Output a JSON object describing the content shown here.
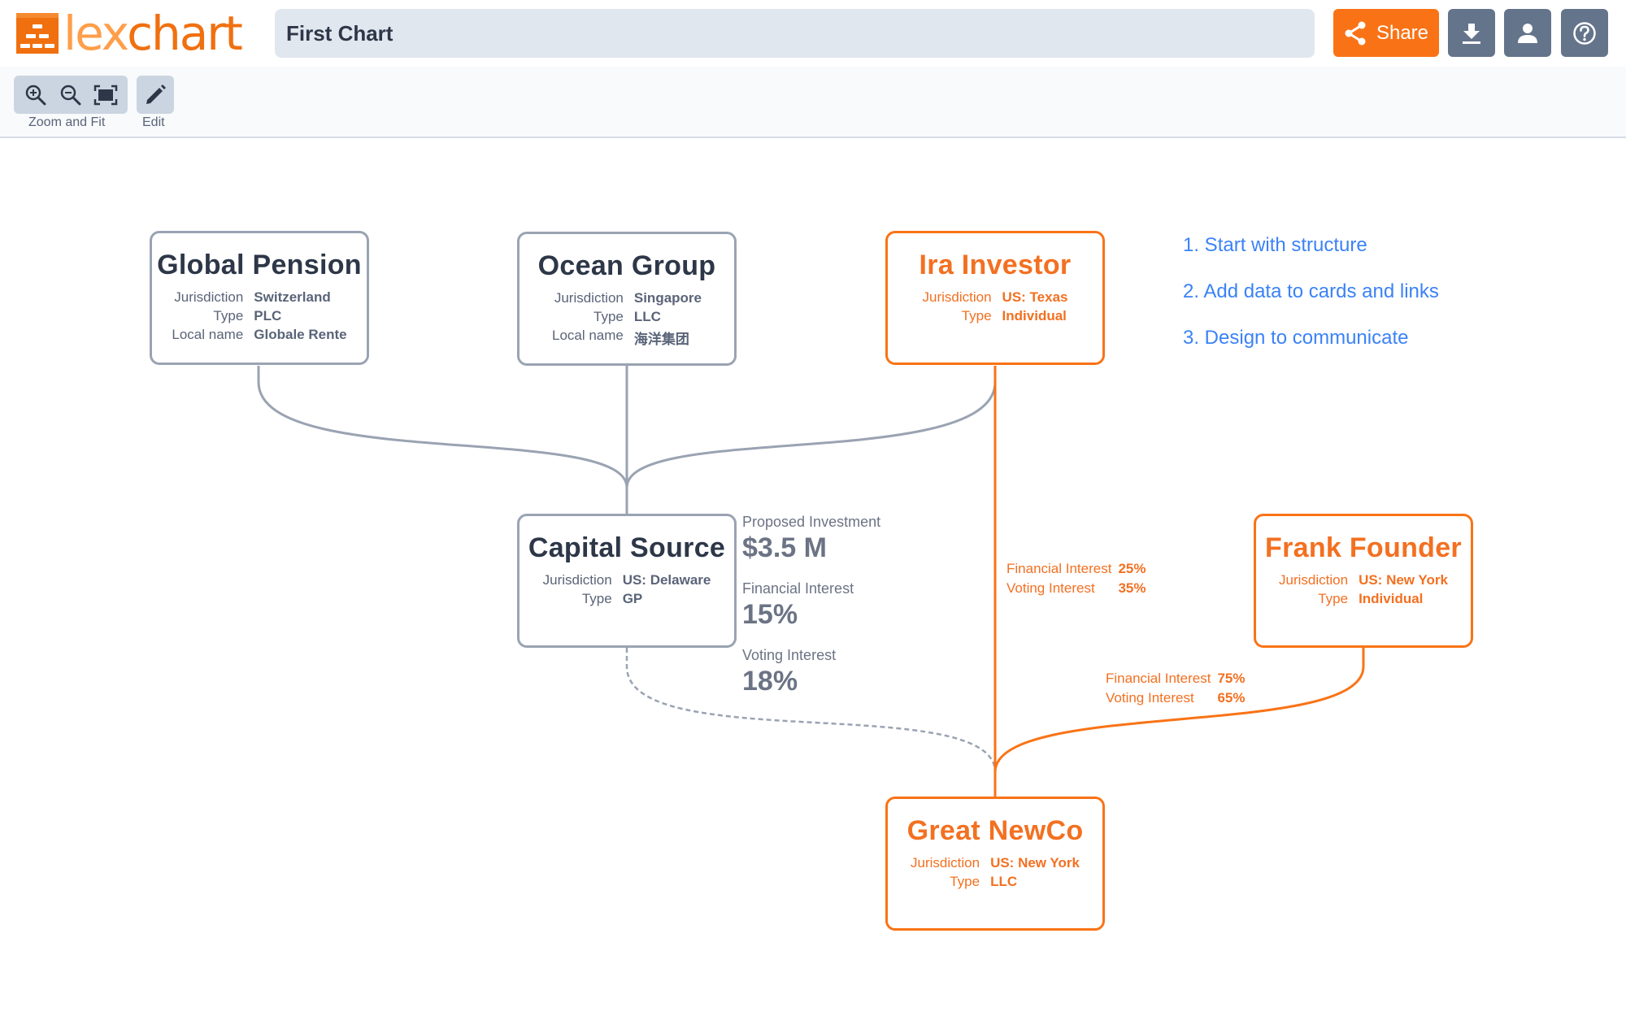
{
  "app": {
    "logo": {
      "part1": "lex",
      "part2": "chart"
    },
    "chart_title": "First Chart",
    "buttons": {
      "share": "Share",
      "download_icon": "download-icon",
      "user_icon": "user-icon",
      "help_icon": "help-icon"
    },
    "toolbar": {
      "zoom_group_label": "Zoom and Fit",
      "edit_label": "Edit",
      "icons": [
        "zoom-in-icon",
        "zoom-out-icon",
        "fit-screen-icon",
        "pencil-icon"
      ]
    }
  },
  "colors": {
    "brand_orange": "#F97316",
    "card_gray_border": "#9AA3B2",
    "link_gray": "#9AA3B2",
    "note_blue": "#3B82F6",
    "button_gray": "#64748B"
  },
  "entities": [
    {
      "id": "global-pension",
      "title": "Global Pension",
      "style": "gray",
      "rows": [
        {
          "label": "Jurisdiction",
          "value": "Switzerland"
        },
        {
          "label": "Type",
          "value": "PLC"
        },
        {
          "label": "Local name",
          "value": "Globale Rente"
        }
      ]
    },
    {
      "id": "ocean-group",
      "title": "Ocean Group",
      "style": "gray",
      "rows": [
        {
          "label": "Jurisdiction",
          "value": "Singapore"
        },
        {
          "label": "Type",
          "value": "LLC"
        },
        {
          "label": "Local name",
          "value": "海洋集团"
        }
      ]
    },
    {
      "id": "ira-investor",
      "title": "Ira Investor",
      "style": "orange",
      "rows": [
        {
          "label": "Jurisdiction",
          "value": "US: Texas"
        },
        {
          "label": "Type",
          "value": "Individual"
        }
      ]
    },
    {
      "id": "capital-source",
      "title": "Capital Source",
      "style": "gray",
      "rows": [
        {
          "label": "Jurisdiction",
          "value": "US: Delaware"
        },
        {
          "label": "Type",
          "value": "GP"
        }
      ]
    },
    {
      "id": "frank-founder",
      "title": "Frank Founder",
      "style": "orange",
      "rows": [
        {
          "label": "Jurisdiction",
          "value": "US: New York"
        },
        {
          "label": "Type",
          "value": "Individual"
        }
      ]
    },
    {
      "id": "great-newco",
      "title": "Great NewCo",
      "style": "orange",
      "rows": [
        {
          "label": "Jurisdiction",
          "value": "US: New York"
        },
        {
          "label": "Type",
          "value": "LLC"
        }
      ]
    }
  ],
  "capital_source_annotation": [
    {
      "label": "Proposed Investment",
      "value": "$3.5 M"
    },
    {
      "label": "Financial Interest",
      "value": "15%"
    },
    {
      "label": "Voting Interest",
      "value": "18%"
    }
  ],
  "links": [
    {
      "from": "global-pension",
      "to": "capital-source",
      "style": "solid-gray"
    },
    {
      "from": "ocean-group",
      "to": "capital-source",
      "style": "solid-gray"
    },
    {
      "from": "ira-investor",
      "to": "capital-source",
      "style": "solid-gray"
    },
    {
      "from": "ira-investor",
      "to": "great-newco",
      "style": "solid-orange",
      "labels": [
        {
          "label": "Financial Interest",
          "value": "25%"
        },
        {
          "label": "Voting Interest",
          "value": "35%"
        }
      ]
    },
    {
      "from": "capital-source",
      "to": "great-newco",
      "style": "dashed-gray"
    },
    {
      "from": "frank-founder",
      "to": "great-newco",
      "style": "solid-orange",
      "labels": [
        {
          "label": "Financial Interest",
          "value": "75%"
        },
        {
          "label": "Voting Interest",
          "value": "65%"
        }
      ]
    }
  ],
  "notes": [
    "1. Start with structure",
    "2. Add data to cards and links",
    "3. Design to communicate"
  ]
}
